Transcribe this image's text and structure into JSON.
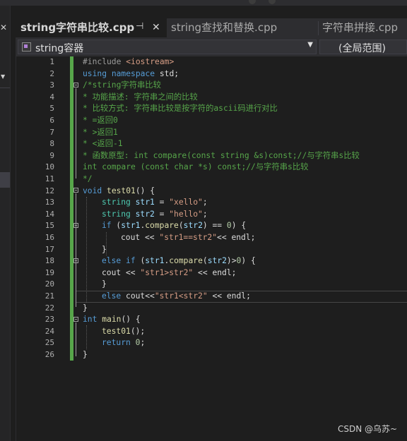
{
  "tabs": [
    {
      "label": "string字符串比较.cpp",
      "active": true
    },
    {
      "label": "string查找和替换.cpp",
      "active": false
    },
    {
      "label": "字符串拼接.cpp",
      "active": false
    }
  ],
  "tab_icons": {
    "pin": "⊣",
    "close": "✕"
  },
  "navbar": {
    "scope_label": "string容器",
    "global_scope": "(全局范围)"
  },
  "left_panel": {
    "close_glyph": "✕",
    "arrow_glyph": "▼"
  },
  "line_numbers": [
    "1",
    "2",
    "3",
    "4",
    "5",
    "6",
    "7",
    "8",
    "9",
    "10",
    "11",
    "12",
    "13",
    "14",
    "15",
    "16",
    "17",
    "18",
    "19",
    "20",
    "21",
    "22",
    "23",
    "24",
    "25",
    "26"
  ],
  "code_lines": [
    "#include <iostream>",
    "using namespace std;",
    "/*string字符串比较",
    "* 功能描述: 字符串之间的比较",
    "* 比较方式: 字符串比较是按字符的ascii码进行对比",
    "* =返回0",
    "* >返回1",
    "* <返回-1",
    "* 函数原型: int compare(const string &s)const;//与字符串s比较",
    "int compare (const char *s) const;//与字符串s比较",
    "*/",
    "void test01() {",
    "string str1 = \"xello\";",
    "string str2 = \"hello\";",
    "if (str1.compare(str2) == 0) {",
    "cout << \"str1==str2\"<< endl;",
    "}",
    "else if (str1.compare(str2)>0) {",
    "cout << \"str1>str2\" << endl;",
    "}",
    "else cout<<\"str1<str2\" << endl;",
    "}",
    "int main() {",
    "test01();",
    "return 0;",
    "}"
  ],
  "watermark": "CSDN @乌苏~",
  "colors": {
    "background": "#1e1e1e",
    "comment": "#57a64a",
    "keyword": "#569cd6",
    "string": "#d69d85",
    "change_bar": "#57a64a"
  }
}
